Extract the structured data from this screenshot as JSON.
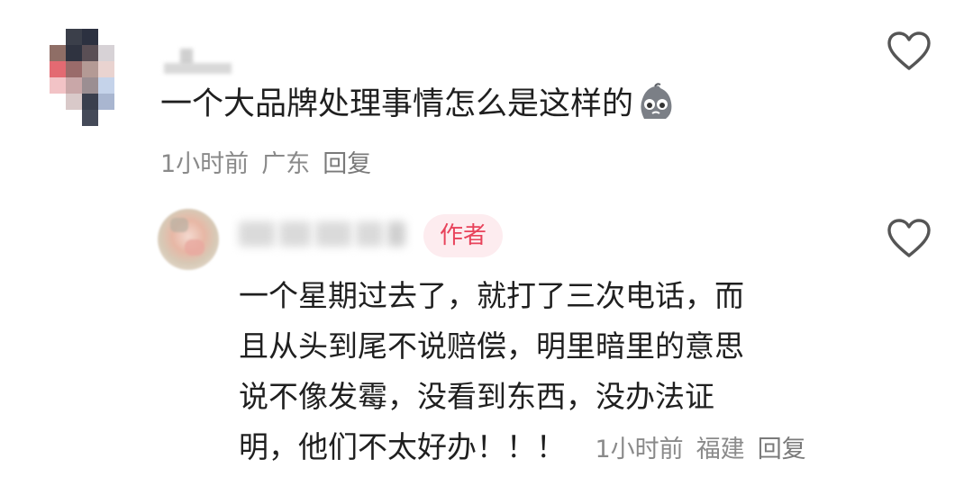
{
  "comment": {
    "text": "一个大品牌处理事情怎么是这样的",
    "emoji_icon": "crying-face-emoji",
    "time": "1小时前",
    "location": "广东",
    "reply_label": "回复"
  },
  "reply": {
    "author_tag": "作者",
    "lines": [
      "一个星期过去了，就打了三次电话，而",
      "且从头到尾不说赔偿，明里暗里的意思",
      "说不像发霉，没看到东西，没办法证",
      "明，他们不太好办！！！"
    ],
    "time": "1小时前",
    "location": "福建",
    "reply_label": "回复"
  },
  "colors": {
    "text": "#1f1f1f",
    "meta": "#8a8a8a",
    "author_tag_bg": "#fdecef",
    "author_tag_text": "#e8435b",
    "heart_stroke": "#555555"
  },
  "icons": [
    "heart-outline-icon",
    "crying-face-emoji"
  ]
}
